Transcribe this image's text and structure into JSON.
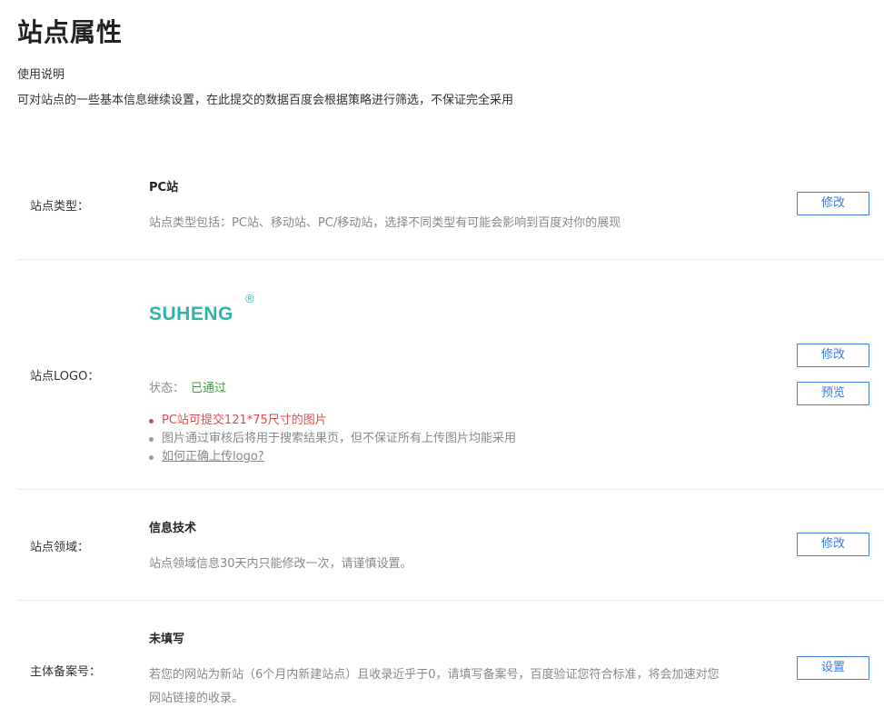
{
  "page": {
    "title": "站点属性",
    "usage_title": "使用说明",
    "usage_desc": "可对站点的一些基本信息继续设置，在此提交的数据百度会根据策略进行筛选，不保证完全采用"
  },
  "site_type": {
    "label": "站点类型：",
    "value": "PC站",
    "desc": "站点类型包括：PC站、移动站、PC/移动站，选择不同类型有可能会影响到百度对你的展现",
    "edit_button": "修改"
  },
  "site_logo": {
    "label": "站点LOGO：",
    "logo_text": "SUHENG",
    "logo_mark": "®",
    "status_label": "状态：",
    "status_value": "已通过",
    "edit_button": "修改",
    "preview_button": "预览",
    "notes": [
      "PC站可提交121*75尺寸的图片",
      "图片通过审核后将用于搜索结果页，但不保证所有上传图片均能采用",
      "如何正确上传logo?"
    ]
  },
  "site_domain": {
    "label": "站点领域：",
    "value": "信息技术",
    "desc": "站点领域信息30天内只能修改一次，请谨慎设置。",
    "edit_button": "修改"
  },
  "icp": {
    "label": "主体备案号：",
    "value": "未填写",
    "desc_line1": "若您的网站为新站（6个月内新建站点）且收录近乎于0，请填写备案号，百度验证您符合标准，将会加速对您",
    "desc_line2": "网站链接的收录。",
    "set_button": "设置"
  },
  "colors": {
    "accent": "#3b7be0",
    "success": "#3aa33a",
    "warning": "#e04b4b",
    "logo": "#2db5a8"
  }
}
